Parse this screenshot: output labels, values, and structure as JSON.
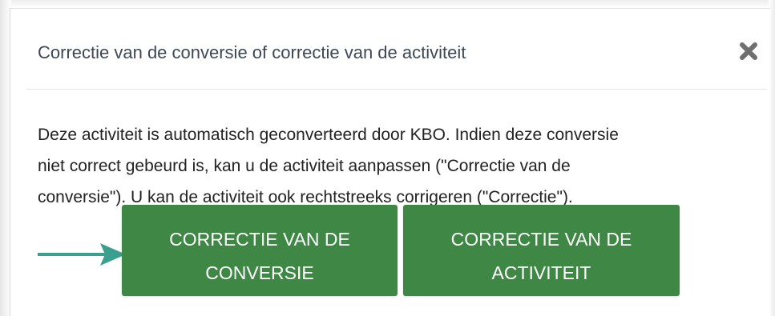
{
  "dialog": {
    "title": "Correctie van de conversie of correctie van de activiteit",
    "close_icon": "close-icon",
    "body_lines": [
      "Deze activiteit is automatisch geconverteerd door KBO. Indien deze conversie",
      "niet correct gebeurd is, kan u de activiteit aanpassen (\"Correctie van de",
      "conversie\"). U kan de activiteit ook rechtstreeks corrigeren (\"Correctie\")."
    ],
    "buttons": {
      "conversie": [
        "CORRECTIE VAN DE",
        "CONVERSIE"
      ],
      "activiteit": [
        "CORRECTIE VAN DE",
        "ACTIVITEIT"
      ]
    },
    "arrow_icon": "arrow-right-icon"
  },
  "colors": {
    "button_green": "#3f8744",
    "arrow_teal": "#3c9e8c",
    "title_text": "#3e4754",
    "close_icon": "#6f6f6f"
  }
}
